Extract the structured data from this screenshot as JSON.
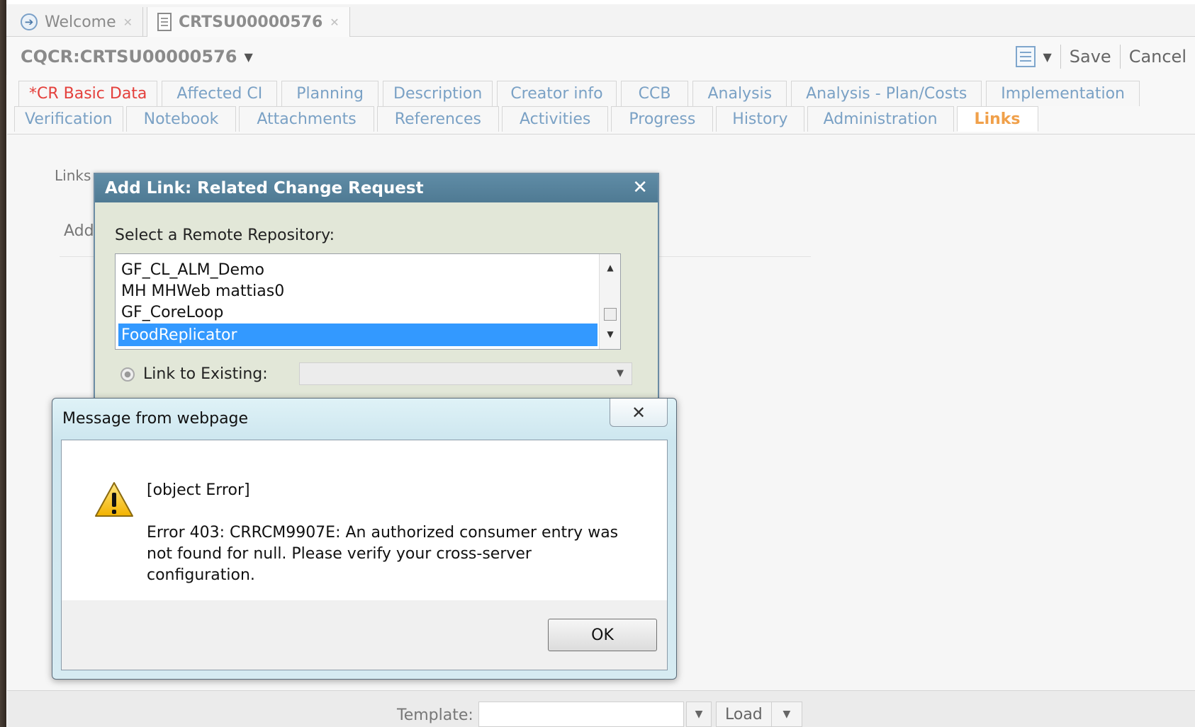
{
  "doc_tabs": [
    {
      "label": "Welcome",
      "icon": "arrow-circle-icon"
    },
    {
      "label": "CRTSU00000576",
      "icon": "document-icon"
    }
  ],
  "record": {
    "title": "CQCR:CRTSU00000576",
    "actions": {
      "save": "Save",
      "cancel": "Cancel"
    }
  },
  "form_tabs": {
    "row1": [
      "*CR Basic Data",
      "Affected CI",
      "Planning",
      "Description",
      "Creator info",
      "CCB",
      "Analysis",
      "Analysis - Plan/Costs",
      "Implementation"
    ],
    "row2": [
      "Verification",
      "Notebook",
      "Attachments",
      "References",
      "Activities",
      "Progress",
      "History",
      "Administration",
      "Links"
    ],
    "active": "Links"
  },
  "content": {
    "links_label": "Links",
    "add_label": "Add"
  },
  "add_link_dialog": {
    "title": "Add Link: Related Change Request",
    "repo_label": "Select a Remote Repository:",
    "repositories": [
      "GF_CL_ALM_Demo",
      "MH MHWeb mattias0",
      "GF_CoreLoop",
      "FoodReplicator"
    ],
    "selected_repository": "FoodReplicator",
    "link_existing_label": "Link to Existing:",
    "link_existing_value": ""
  },
  "message_dialog": {
    "title": "Message from webpage",
    "line1": "[object Error]",
    "line2": "Error 403: CRRCM9907E: An authorized consumer entry was not found for null.  Please verify your cross-server configuration.",
    "ok": "OK",
    "icon": "warning-icon"
  },
  "bottom": {
    "template_label": "Template:",
    "template_value": "",
    "load": "Load"
  },
  "colors": {
    "tab_text": "#7aa1c5",
    "required_tab": "#e4403c",
    "active_tab": "#f0a04a",
    "dialog_title": "#5f8ca6",
    "selection": "#3399ff"
  }
}
